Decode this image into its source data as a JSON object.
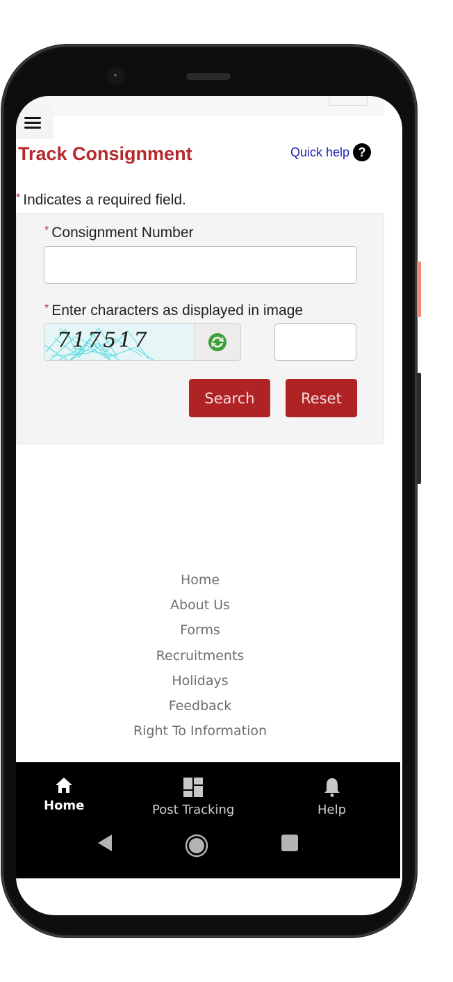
{
  "header": {
    "menu_icon": "hamburger-menu-icon",
    "title": "Track Consignment",
    "quick_help_label": "Quick help",
    "help_icon_glyph": "?"
  },
  "form": {
    "required_star": "*",
    "required_note": "Indicates a required field.",
    "consignment_label": "Consignment Number",
    "consignment_value": "",
    "consignment_placeholder": "",
    "captcha_label": "Enter characters as displayed in image",
    "captcha_text": "717517",
    "captcha_input_value": "",
    "refresh_icon": "refresh-icon",
    "search_label": "Search",
    "reset_label": "Reset"
  },
  "footer": {
    "links": [
      "Home",
      "About Us",
      "Forms",
      "Recruitments",
      "Holidays",
      "Feedback",
      "Right To Information"
    ]
  },
  "bottom_nav": {
    "items": [
      {
        "label": "Home",
        "icon": "home-icon",
        "active": true
      },
      {
        "label": "Post Tracking",
        "icon": "dashboard-icon",
        "active": false
      },
      {
        "label": "Help",
        "icon": "bell-icon",
        "active": false
      }
    ]
  },
  "system_nav": {
    "buttons": [
      "back",
      "home",
      "recents"
    ]
  },
  "colors": {
    "brand_red": "#b5282c",
    "button_red": "#b02325",
    "link_blue": "#2323b8",
    "panel_bg": "#f4f4f4"
  }
}
